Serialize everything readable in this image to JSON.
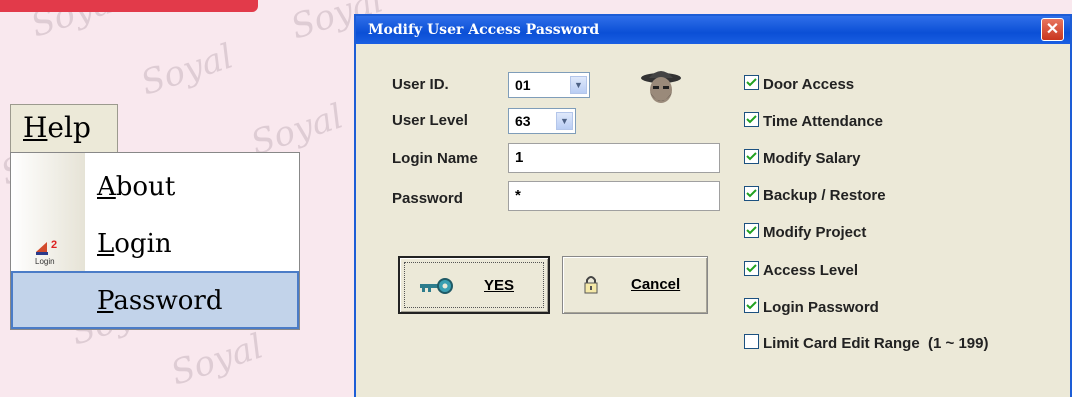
{
  "watermark": "Soyal",
  "menu": {
    "title_first": "H",
    "title_rest": "elp",
    "items": [
      {
        "first": "A",
        "rest": "bout",
        "icon": ""
      },
      {
        "first": "L",
        "rest": "ogin",
        "icon": "login-icon"
      },
      {
        "first": "P",
        "rest": "assword",
        "icon": ""
      }
    ]
  },
  "dialog": {
    "title": "Modify User Access Password",
    "close": "✕",
    "user_id_label": "User ID.",
    "user_id_value": "01",
    "user_level_label": "User Level",
    "user_level_value": "63",
    "login_name_label": "Login Name",
    "login_name_value": "1",
    "password_label": "Password",
    "password_value": "*",
    "checkboxes": [
      {
        "label": "Door Access",
        "checked": true
      },
      {
        "label": "Time Attendance",
        "checked": true
      },
      {
        "label": "Modify Salary",
        "checked": true
      },
      {
        "label": "Backup / Restore",
        "checked": true
      },
      {
        "label": "Modify Project",
        "checked": true
      },
      {
        "label": "Access Level",
        "checked": true
      },
      {
        "label": "Login Password",
        "checked": true
      },
      {
        "label": "Limit Card Edit Range  (1 ~ 199)",
        "checked": false
      }
    ],
    "yes_label": "YES",
    "cancel_label": "Cancel"
  },
  "colors": {
    "accent": "#0b4fd6",
    "checkmark": "#21a121",
    "selection": "#c2d3ea"
  }
}
